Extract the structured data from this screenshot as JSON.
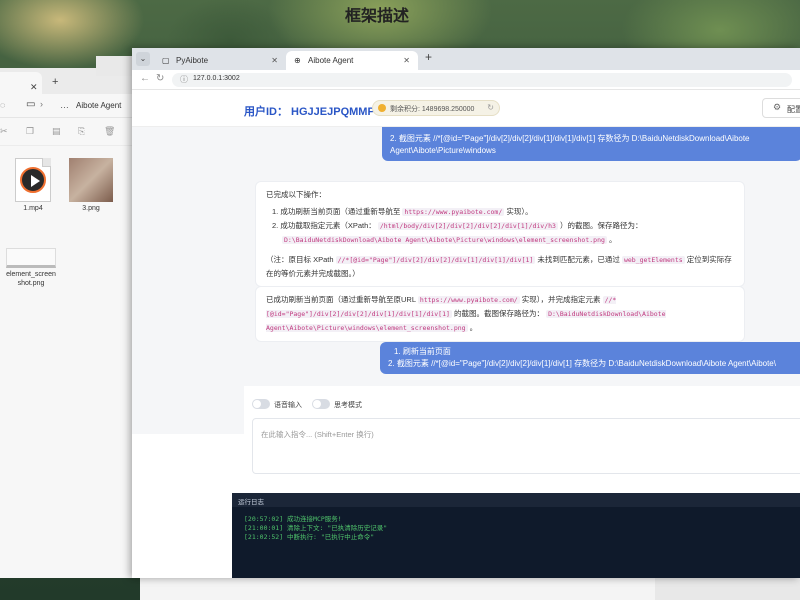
{
  "explorer": {
    "breadcrumb": "Aibote Agent",
    "files": [
      {
        "name": "1.mp4",
        "kind": "video"
      },
      {
        "name": "3.png",
        "kind": "image"
      },
      {
        "name": "element_screen shot.png",
        "kind": "image"
      }
    ]
  },
  "browser": {
    "tabs": [
      {
        "title": "PyAibote",
        "active": false
      },
      {
        "title": "Aibote Agent",
        "active": true
      }
    ],
    "url": "127.0.0.1:3002"
  },
  "app": {
    "user_id": "用户ID： HGJJEJPQMMPT",
    "score": "剩余积分: 1489698.250000",
    "config_label": "配置"
  },
  "chat": {
    "user_msg_top_line1": "2. 截图元素 //*[@id=\"Page\"]/div[2]/div[2]/div[1]/div[1]/div[1] 存数径为 D:\\BaiduNetdiskDownload\\Aibote",
    "user_msg_top_line2": "Agent\\Aibote\\Picture\\windows",
    "ai1": {
      "intro": "已完成以下操作：",
      "item1_prefix": "1. 成功刷新当前页面（通过重新导航至 ",
      "item1_code": "https://www.pyaibote.com/",
      "item1_suffix": " 实现）。",
      "item2_prefix": "2. 成功截取指定元素（XPath： ",
      "item2_code": "/html/body/div[2]/div[2]/div[2]/div[1]/div/h3",
      "item2_suffix": " ）的截图。保存路径为：",
      "item2_path": "D:\\BaiduNetdiskDownload\\Aibote Agent\\Aibote\\Picture\\windows\\element_screenshot.png",
      "note_prefix": "（注：原目标 XPath ",
      "note_code1": "//*[@id=\"Page\"]/div[2]/div[2]/div[1]/div[1]/div[1]",
      "note_mid": " 未找到匹配元素，已通过 ",
      "note_code2": "web_getElements",
      "note_suffix": " 定位到实际存",
      "note_line2": "在的等价元素并完成截图。）"
    },
    "ai2": {
      "prefix": "已成功刷新当前页面（通过重新导航至原URL ",
      "code1": "https://www.pyaibote.com/",
      "mid": " 实现），并完成指定元素 ",
      "code2": "//*[@id=\"Page\"]/div[2]/div[2]/div[1]/div[1]/div[1]",
      "mid2": " 的截图。截图保存路径为： ",
      "code3": "D:\\BaiduNetdiskDownload\\Aibote Agent\\Aibote\\Picture\\windows\\element_screenshot.png",
      "end": " 。"
    },
    "user_msg2_line1": "1. 刷新当前页面",
    "user_msg2_line2": "2. 截图元素 //*[@id=\"Page\"]/div[2]/div[2]/div[1]/div[1]  存数径为 D:\\BaiduNetdiskDownload\\Aibote Agent\\Aibote\\"
  },
  "input": {
    "voice_label": "语音输入",
    "think_label": "思考模式",
    "placeholder": "在此输入指令... (Shift+Enter 换行)"
  },
  "log": {
    "title": "运行日志",
    "lines": [
      "[20:57:02] 成功连接MCP服务!",
      "[21:00:01] 清除上下文: \"已执清除历史记录\"",
      "[21:02:52] 中断执行: \"已执行中止命令\""
    ]
  },
  "background": {
    "doc_heading": "框架描述"
  }
}
